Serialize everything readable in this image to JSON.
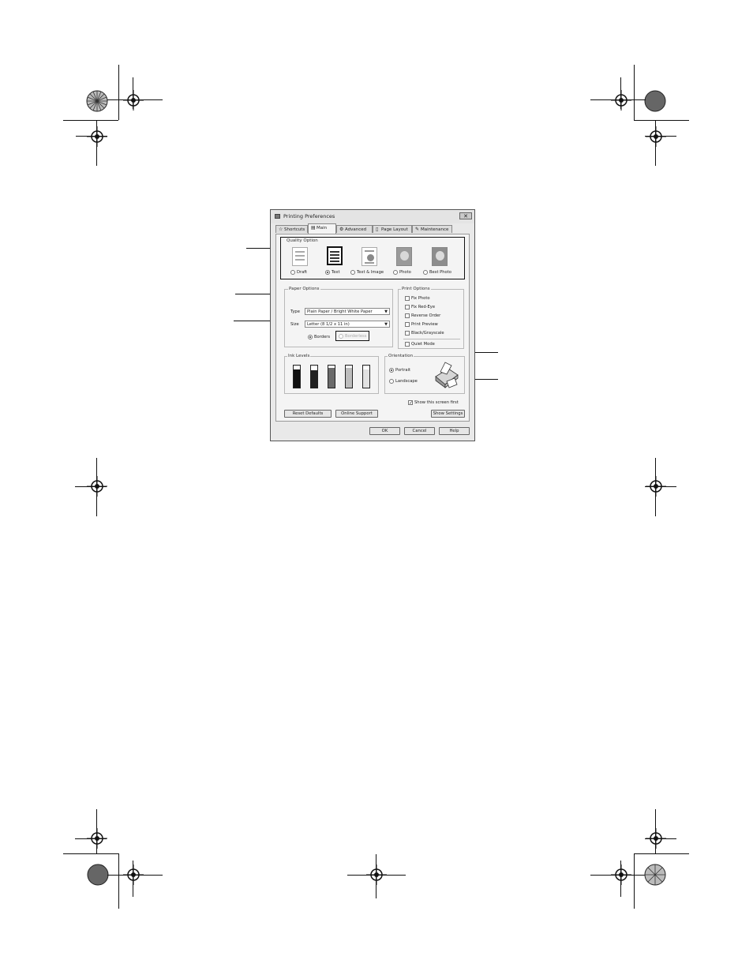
{
  "dialog": {
    "title": "Printing Preferences",
    "close_glyph": "✕"
  },
  "tabs": [
    {
      "label": "Shortcuts",
      "icon": "star-icon"
    },
    {
      "label": "Main",
      "icon": "printer-icon"
    },
    {
      "label": "Advanced",
      "icon": "gear-icon"
    },
    {
      "label": "Page Layout",
      "icon": "page-icon"
    },
    {
      "label": "Maintenance",
      "icon": "wrench-icon"
    }
  ],
  "quality": {
    "group_label": "Quality Option",
    "options": [
      {
        "label": "Draft",
        "selected": false
      },
      {
        "label": "Text",
        "selected": true
      },
      {
        "label": "Text & Image",
        "selected": false
      },
      {
        "label": "Photo",
        "selected": false
      },
      {
        "label": "Best Photo",
        "selected": false
      }
    ]
  },
  "paper": {
    "group_label": "Paper Options",
    "type_label": "Type",
    "type_value": "Plain Paper / Bright White Paper",
    "size_label": "Size",
    "size_value": "Letter (8 1/2 x 11 in)",
    "borders_label": "Borders",
    "borderless_label": "Borderless"
  },
  "print_options": {
    "group_label": "Print Options",
    "items": [
      {
        "label": "Fix Photo",
        "checked": false
      },
      {
        "label": "Fix Red-Eye",
        "checked": false
      },
      {
        "label": "Reverse Order",
        "checked": false
      },
      {
        "label": "Print Preview",
        "checked": false
      },
      {
        "label": "Black/Grayscale",
        "checked": false
      }
    ],
    "quiet_mode": "Quiet Mode"
  },
  "ink": {
    "group_label": "Ink Levels",
    "colors": [
      "#111111",
      "#222222",
      "#6a6a6a",
      "#bdbdbd",
      "#e2e2e2"
    ],
    "levels": [
      0.9,
      0.85,
      0.95,
      0.95,
      0.9
    ]
  },
  "orientation": {
    "group_label": "Orientation",
    "portrait": "Portrait",
    "landscape": "Landscape"
  },
  "footer": {
    "show_first": "Show this screen first",
    "check_glyph": "✓",
    "reset": "Reset Defaults",
    "online": "Online Support",
    "show_settings": "Show Settings",
    "ok": "OK",
    "cancel": "Cancel",
    "help": "Help"
  }
}
